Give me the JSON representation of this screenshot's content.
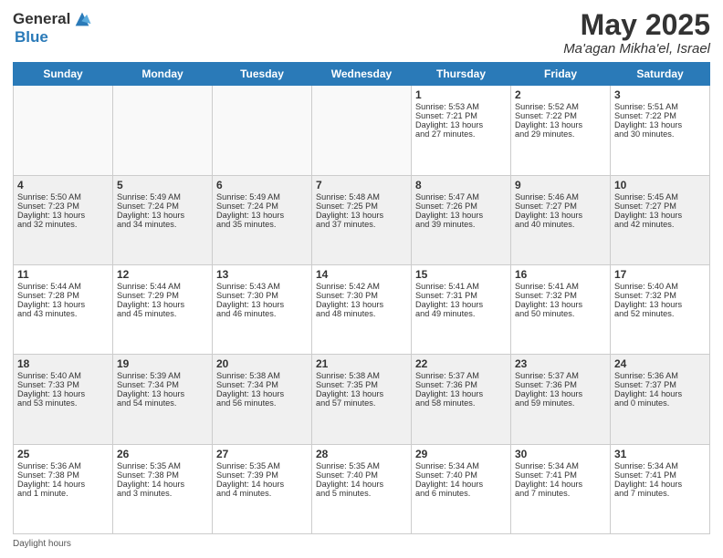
{
  "header": {
    "logo_general": "General",
    "logo_blue": "Blue",
    "title": "May 2025",
    "location": "Ma'agan Mikha'el, Israel"
  },
  "days_of_week": [
    "Sunday",
    "Monday",
    "Tuesday",
    "Wednesday",
    "Thursday",
    "Friday",
    "Saturday"
  ],
  "weeks": [
    [
      {
        "day": "",
        "empty": true
      },
      {
        "day": "",
        "empty": true
      },
      {
        "day": "",
        "empty": true
      },
      {
        "day": "",
        "empty": true
      },
      {
        "day": "1",
        "line1": "Sunrise: 5:53 AM",
        "line2": "Sunset: 7:21 PM",
        "line3": "Daylight: 13 hours",
        "line4": "and 27 minutes."
      },
      {
        "day": "2",
        "line1": "Sunrise: 5:52 AM",
        "line2": "Sunset: 7:22 PM",
        "line3": "Daylight: 13 hours",
        "line4": "and 29 minutes."
      },
      {
        "day": "3",
        "line1": "Sunrise: 5:51 AM",
        "line2": "Sunset: 7:22 PM",
        "line3": "Daylight: 13 hours",
        "line4": "and 30 minutes."
      }
    ],
    [
      {
        "day": "4",
        "line1": "Sunrise: 5:50 AM",
        "line2": "Sunset: 7:23 PM",
        "line3": "Daylight: 13 hours",
        "line4": "and 32 minutes."
      },
      {
        "day": "5",
        "line1": "Sunrise: 5:49 AM",
        "line2": "Sunset: 7:24 PM",
        "line3": "Daylight: 13 hours",
        "line4": "and 34 minutes."
      },
      {
        "day": "6",
        "line1": "Sunrise: 5:49 AM",
        "line2": "Sunset: 7:24 PM",
        "line3": "Daylight: 13 hours",
        "line4": "and 35 minutes."
      },
      {
        "day": "7",
        "line1": "Sunrise: 5:48 AM",
        "line2": "Sunset: 7:25 PM",
        "line3": "Daylight: 13 hours",
        "line4": "and 37 minutes."
      },
      {
        "day": "8",
        "line1": "Sunrise: 5:47 AM",
        "line2": "Sunset: 7:26 PM",
        "line3": "Daylight: 13 hours",
        "line4": "and 39 minutes."
      },
      {
        "day": "9",
        "line1": "Sunrise: 5:46 AM",
        "line2": "Sunset: 7:27 PM",
        "line3": "Daylight: 13 hours",
        "line4": "and 40 minutes."
      },
      {
        "day": "10",
        "line1": "Sunrise: 5:45 AM",
        "line2": "Sunset: 7:27 PM",
        "line3": "Daylight: 13 hours",
        "line4": "and 42 minutes."
      }
    ],
    [
      {
        "day": "11",
        "line1": "Sunrise: 5:44 AM",
        "line2": "Sunset: 7:28 PM",
        "line3": "Daylight: 13 hours",
        "line4": "and 43 minutes."
      },
      {
        "day": "12",
        "line1": "Sunrise: 5:44 AM",
        "line2": "Sunset: 7:29 PM",
        "line3": "Daylight: 13 hours",
        "line4": "and 45 minutes."
      },
      {
        "day": "13",
        "line1": "Sunrise: 5:43 AM",
        "line2": "Sunset: 7:30 PM",
        "line3": "Daylight: 13 hours",
        "line4": "and 46 minutes."
      },
      {
        "day": "14",
        "line1": "Sunrise: 5:42 AM",
        "line2": "Sunset: 7:30 PM",
        "line3": "Daylight: 13 hours",
        "line4": "and 48 minutes."
      },
      {
        "day": "15",
        "line1": "Sunrise: 5:41 AM",
        "line2": "Sunset: 7:31 PM",
        "line3": "Daylight: 13 hours",
        "line4": "and 49 minutes."
      },
      {
        "day": "16",
        "line1": "Sunrise: 5:41 AM",
        "line2": "Sunset: 7:32 PM",
        "line3": "Daylight: 13 hours",
        "line4": "and 50 minutes."
      },
      {
        "day": "17",
        "line1": "Sunrise: 5:40 AM",
        "line2": "Sunset: 7:32 PM",
        "line3": "Daylight: 13 hours",
        "line4": "and 52 minutes."
      }
    ],
    [
      {
        "day": "18",
        "line1": "Sunrise: 5:40 AM",
        "line2": "Sunset: 7:33 PM",
        "line3": "Daylight: 13 hours",
        "line4": "and 53 minutes."
      },
      {
        "day": "19",
        "line1": "Sunrise: 5:39 AM",
        "line2": "Sunset: 7:34 PM",
        "line3": "Daylight: 13 hours",
        "line4": "and 54 minutes."
      },
      {
        "day": "20",
        "line1": "Sunrise: 5:38 AM",
        "line2": "Sunset: 7:34 PM",
        "line3": "Daylight: 13 hours",
        "line4": "and 56 minutes."
      },
      {
        "day": "21",
        "line1": "Sunrise: 5:38 AM",
        "line2": "Sunset: 7:35 PM",
        "line3": "Daylight: 13 hours",
        "line4": "and 57 minutes."
      },
      {
        "day": "22",
        "line1": "Sunrise: 5:37 AM",
        "line2": "Sunset: 7:36 PM",
        "line3": "Daylight: 13 hours",
        "line4": "and 58 minutes."
      },
      {
        "day": "23",
        "line1": "Sunrise: 5:37 AM",
        "line2": "Sunset: 7:36 PM",
        "line3": "Daylight: 13 hours",
        "line4": "and 59 minutes."
      },
      {
        "day": "24",
        "line1": "Sunrise: 5:36 AM",
        "line2": "Sunset: 7:37 PM",
        "line3": "Daylight: 14 hours",
        "line4": "and 0 minutes."
      }
    ],
    [
      {
        "day": "25",
        "line1": "Sunrise: 5:36 AM",
        "line2": "Sunset: 7:38 PM",
        "line3": "Daylight: 14 hours",
        "line4": "and 1 minute."
      },
      {
        "day": "26",
        "line1": "Sunrise: 5:35 AM",
        "line2": "Sunset: 7:38 PM",
        "line3": "Daylight: 14 hours",
        "line4": "and 3 minutes."
      },
      {
        "day": "27",
        "line1": "Sunrise: 5:35 AM",
        "line2": "Sunset: 7:39 PM",
        "line3": "Daylight: 14 hours",
        "line4": "and 4 minutes."
      },
      {
        "day": "28",
        "line1": "Sunrise: 5:35 AM",
        "line2": "Sunset: 7:40 PM",
        "line3": "Daylight: 14 hours",
        "line4": "and 5 minutes."
      },
      {
        "day": "29",
        "line1": "Sunrise: 5:34 AM",
        "line2": "Sunset: 7:40 PM",
        "line3": "Daylight: 14 hours",
        "line4": "and 6 minutes."
      },
      {
        "day": "30",
        "line1": "Sunrise: 5:34 AM",
        "line2": "Sunset: 7:41 PM",
        "line3": "Daylight: 14 hours",
        "line4": "and 7 minutes."
      },
      {
        "day": "31",
        "line1": "Sunrise: 5:34 AM",
        "line2": "Sunset: 7:41 PM",
        "line3": "Daylight: 14 hours",
        "line4": "and 7 minutes."
      }
    ]
  ],
  "footer": {
    "daylight_label": "Daylight hours"
  }
}
